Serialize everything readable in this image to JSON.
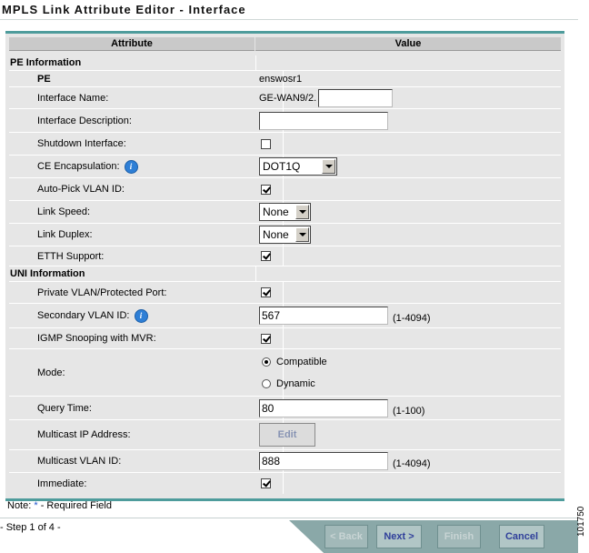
{
  "window": {
    "title": "MPLS Link Attribute Editor - Interface"
  },
  "table": {
    "headers": {
      "attribute": "Attribute",
      "value": "Value"
    }
  },
  "pe_section": {
    "heading": "PE Information",
    "pe": {
      "label": "PE",
      "value": "enswosr1"
    },
    "interface_name": {
      "label": "Interface Name:",
      "prefix": "GE-WAN9/2.",
      "value": ""
    },
    "interface_description": {
      "label": "Interface Description:",
      "value": ""
    },
    "shutdown_interface": {
      "label": "Shutdown Interface:",
      "checked": false
    },
    "ce_encapsulation": {
      "label": "CE Encapsulation:",
      "selected": "DOT1Q"
    },
    "auto_pick_vlan": {
      "label": "Auto-Pick VLAN ID:",
      "checked": true
    },
    "link_speed": {
      "label": "Link Speed:",
      "selected": "None"
    },
    "link_duplex": {
      "label": "Link Duplex:",
      "selected": "None"
    },
    "etth_support": {
      "label": "ETTH Support:",
      "checked": true
    }
  },
  "uni_section": {
    "heading": "UNI Information",
    "private_vlan": {
      "label": "Private VLAN/Protected Port:",
      "checked": true
    },
    "secondary_vlan": {
      "label": "Secondary VLAN ID:",
      "value": "567",
      "range": "(1-4094)"
    },
    "igmp_snooping": {
      "label": "IGMP Snooping with MVR:",
      "checked": true
    },
    "mode": {
      "label": "Mode:",
      "options": [
        "Compatible",
        "Dynamic"
      ],
      "selected": "Compatible"
    },
    "query_time": {
      "label": "Query Time:",
      "value": "80",
      "range": "(1-100)"
    },
    "multicast_ip": {
      "label": "Multicast IP Address:",
      "button": "Edit"
    },
    "multicast_vlan": {
      "label": "Multicast VLAN ID:",
      "value": "888",
      "range": "(1-4094)"
    },
    "immediate": {
      "label": "Immediate:",
      "checked": true
    }
  },
  "footer": {
    "note_prefix": "Note: ",
    "note_star": "*",
    "note_suffix": " - Required Field",
    "step": "- Step 1 of 4 -",
    "buttons": {
      "back": "< Back",
      "next": "Next >",
      "finish": "Finish",
      "cancel": "Cancel"
    },
    "figure_id": "101750"
  },
  "colors": {
    "accent_rule": "#4e9c9c",
    "nav_bar": "#8aa8a8",
    "info_icon": "#2e7fd6"
  }
}
